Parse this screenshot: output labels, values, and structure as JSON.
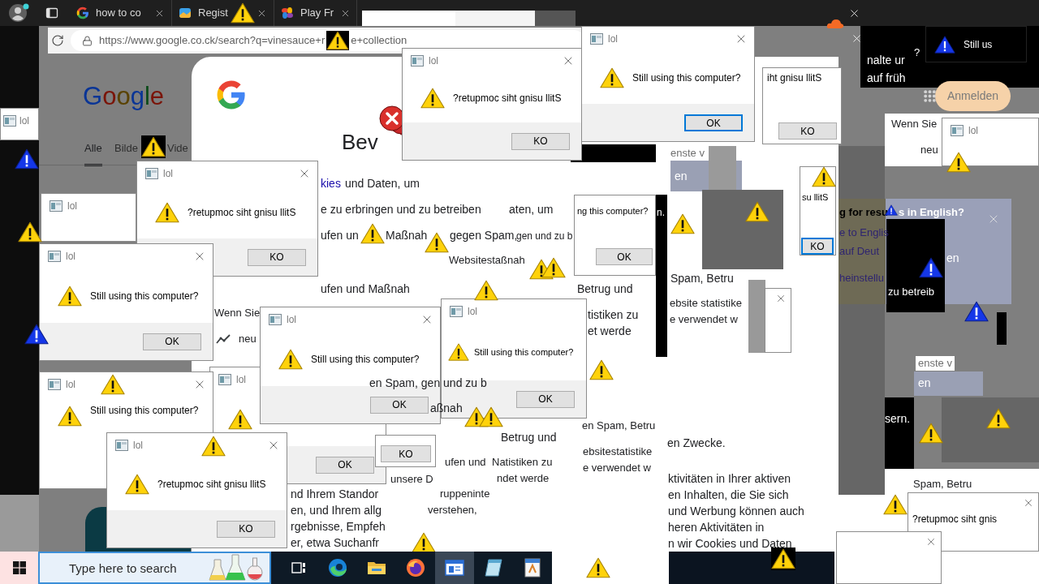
{
  "browser": {
    "tabs": [
      {
        "title": "how to co",
        "kind": "g-logo",
        "selected": false
      },
      {
        "title": "Regist",
        "kind": "picture",
        "selected": false
      },
      {
        "title": "Play Fr",
        "kind": "pinwheel",
        "selected": false
      }
    ],
    "address": {
      "url_start": "https://www.google.co.ck/search?q=vinesauce+r",
      "url_end": "e+collection"
    }
  },
  "results_page": {
    "logo": "Google",
    "tabs": [
      {
        "label": "Alle",
        "selected": true
      },
      {
        "label": "Bilde",
        "selected": false
      },
      {
        "label": "Vide",
        "selected": false
      }
    ],
    "sign_in": "Anmelden"
  },
  "page_text": {
    "top_right": [
      {
        "text": "nalte ur",
        "kind": "light"
      },
      {
        "text": "?",
        "kind": "light"
      },
      {
        "text": "auf früh",
        "kind": "light"
      }
    ],
    "heading": "Bev",
    "consent": [
      {
        "text": "kies",
        "kind": "link"
      },
      {
        "text": "und Daten, um",
        "kind": "text"
      },
      {
        "text": "e zu erbringen und zu betreiben",
        "kind": "text"
      },
      {
        "text": "aten, um",
        "kind": "text"
      },
      {
        "text": "ufen un",
        "kind": "text"
      },
      {
        "text": "Maßnah",
        "kind": "text"
      },
      {
        "text": "gegen Spam,",
        "kind": "text"
      },
      {
        "text": "gen und zu b",
        "kind": "text"
      },
      {
        "text": "Websitestaßnah",
        "kind": "text"
      },
      {
        "text": "ufen und Maßnah",
        "kind": "text"
      }
    ],
    "left_column": [
      {
        "text": "Wenn Sie",
        "kind": "text"
      },
      {
        "text": "neu",
        "kind": "text"
      }
    ],
    "middle_column": [
      {
        "text": "enste v",
        "kind": "muted"
      },
      {
        "text": "en",
        "kind": "light"
      },
      {
        "text": "n.",
        "kind": "light"
      },
      {
        "text": "Betrug und",
        "kind": "text"
      },
      {
        "text": "Spam, Betru",
        "kind": "text"
      },
      {
        "text": "tistiken zu",
        "kind": "text"
      },
      {
        "text": "et werde",
        "kind": "text"
      },
      {
        "text": "ebsite statistike",
        "kind": "text"
      },
      {
        "text": "e verwendet w",
        "kind": "text"
      }
    ],
    "over_dialogs": [
      {
        "text": "en Spam, gen und zu b",
        "kind": "text"
      },
      {
        "text": "aßnah",
        "kind": "text"
      }
    ],
    "lower_center": [
      {
        "text": "Betrug und",
        "kind": "text"
      },
      {
        "text": "ufen und",
        "kind": "text"
      },
      {
        "text": "Natistiken zu",
        "kind": "text"
      },
      {
        "text": "unsere D",
        "kind": "text"
      },
      {
        "text": "ndet werde",
        "kind": "text"
      },
      {
        "text": "ruppeninte",
        "kind": "text"
      },
      {
        "text": "verstehen,",
        "kind": "text"
      }
    ],
    "lower_left": [
      {
        "text": "nd Ihrem Standor",
        "kind": "text"
      },
      {
        "text": "en, und Ihrem allg",
        "kind": "text"
      },
      {
        "text": "rgebnisse, Empfeh",
        "kind": "text"
      },
      {
        "text": "er, etwa Suchanfr",
        "kind": "text"
      }
    ],
    "lower_right": [
      {
        "text": "en Spam, Betru",
        "kind": "text"
      },
      {
        "text": "ebsitestatistike",
        "kind": "text"
      },
      {
        "text": "e verwendet w",
        "kind": "text"
      },
      {
        "text": "en Zwecke.",
        "kind": "text"
      },
      {
        "text": "ktivitäten in Ihrer aktiven",
        "kind": "text"
      },
      {
        "text": "en Inhalten, die Sie sich",
        "kind": "text"
      },
      {
        "text": "und Werbung können auch",
        "kind": "text"
      },
      {
        "text": "heren Aktivitäten in",
        "kind": "text"
      },
      {
        "text": "n wir Cookies und Daten",
        "kind": "text"
      }
    ],
    "right_panel": [
      {
        "text": "Wenn Sie",
        "kind": "text"
      },
      {
        "text": "neu",
        "kind": "text"
      },
      {
        "text": "en",
        "kind": "light"
      },
      {
        "text": "zu betreib",
        "kind": "light"
      },
      {
        "text": "enste v",
        "kind": "muted"
      },
      {
        "text": "en",
        "kind": "light"
      },
      {
        "text": "sern.",
        "kind": "light"
      },
      {
        "text": "Spam, Betru",
        "kind": "text"
      }
    ]
  },
  "language_prompt": {
    "title_start": "g for resu",
    "title_end": "s in English?",
    "links": [
      "e to Englis",
      "auf Deut",
      "heinstellu"
    ]
  },
  "dialogs": [
    {
      "title": "lol",
      "message": "?retupmoc siht gnisu llitS",
      "button": "KO",
      "focused": false,
      "close": true,
      "inverted": false
    },
    {
      "title": "lol",
      "message": "Still using this computer?",
      "button": "OK",
      "focused": true,
      "close": true,
      "inverted": false
    },
    {
      "message": "iht gnisu llitS",
      "button": "KO",
      "focused": false,
      "close": false,
      "inverted": false
    },
    {
      "title": "lol",
      "message": "?retupmoc siht gnisu llitS",
      "button": "KO",
      "focused": false,
      "close": true,
      "inverted": false
    },
    {
      "title": "lol",
      "message": "Still using this computer?",
      "button": "OK",
      "focused": false,
      "close": true,
      "inverted": false
    },
    {
      "message": "ng this computer?",
      "button": "OK",
      "focused": false,
      "close": false,
      "inverted": false
    },
    {
      "title": "lol",
      "button": "OK",
      "focused": false,
      "close": false,
      "inverted": false
    },
    {
      "title": "lol",
      "message": "Still using this computer?",
      "button": "OK",
      "focused": false,
      "close": true,
      "inverted": false
    },
    {
      "title": "lol",
      "message": "Still using this computer?",
      "button": "OK",
      "focused": false,
      "close": false,
      "inverted": false
    },
    {
      "title": "lol",
      "message": "Still using this computer?",
      "close": true,
      "inverted": false
    },
    {
      "title": "lol",
      "message": "?retupmoc siht gnisu llitS",
      "button": "KO",
      "focused": false,
      "close": true,
      "inverted": false
    },
    {
      "title": "lol",
      "close": false,
      "inverted": false
    },
    {
      "title": "lol",
      "close": false,
      "inverted": false
    },
    {
      "title": "lol",
      "close": false,
      "inverted": false
    },
    {
      "message": "Still us",
      "close": false,
      "inverted": true
    },
    {
      "message": "su llitS",
      "button": "KO",
      "focused": true,
      "close": false,
      "inverted": false
    },
    {
      "message": "?retupmoc siht gnis",
      "close": true,
      "inverted": false
    },
    {
      "close": true,
      "inverted": false
    },
    {
      "button": "KO",
      "focused": false,
      "close": false,
      "inverted": false
    },
    {
      "close": true,
      "inverted": false
    }
  ],
  "taskbar": {
    "search_placeholder": "Type here to search",
    "apps": [
      {
        "kind": "task-view",
        "selected": false
      },
      {
        "kind": "swirl",
        "selected": false
      },
      {
        "kind": "folder",
        "selected": false
      },
      {
        "kind": "flame-globe",
        "selected": false
      },
      {
        "kind": "window",
        "selected": true
      },
      {
        "kind": "pad",
        "selected": false
      },
      {
        "kind": "sheet",
        "selected": false
      }
    ]
  }
}
